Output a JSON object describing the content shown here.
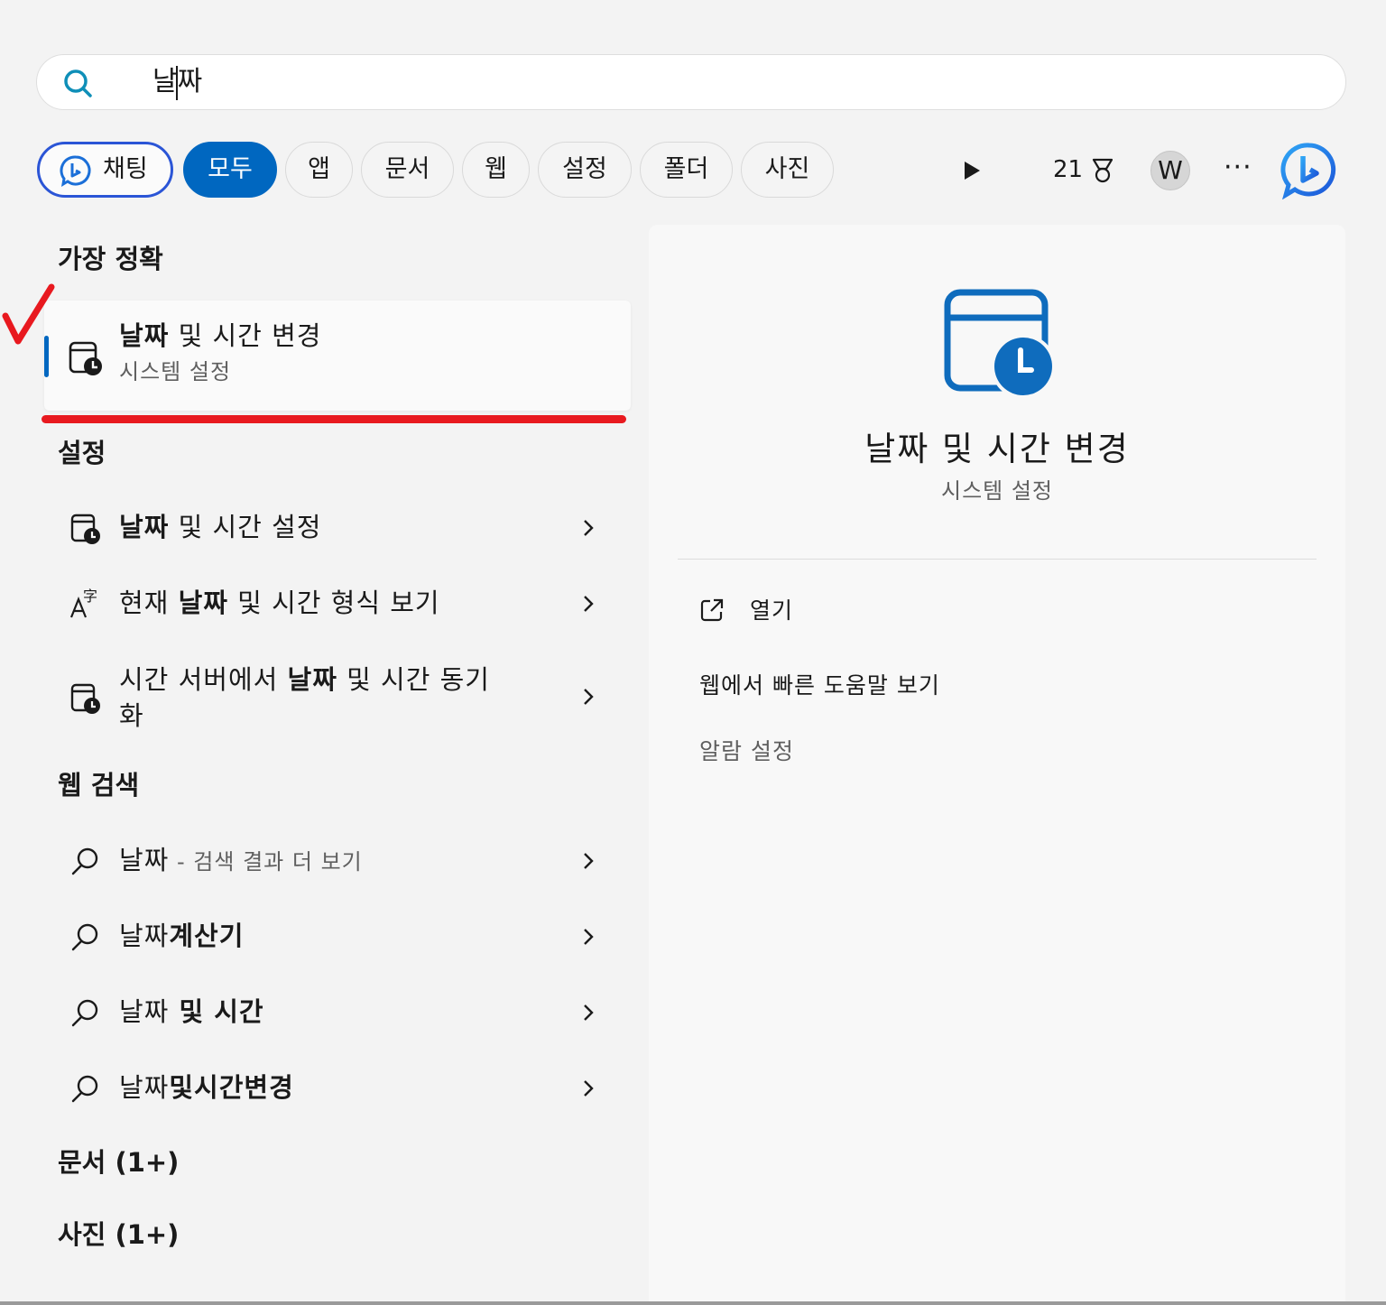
{
  "search": {
    "query": "날짜"
  },
  "filters": {
    "chat": "채팅",
    "tabs": [
      "모두",
      "앱",
      "문서",
      "웹",
      "설정",
      "폴더",
      "사진"
    ]
  },
  "toolbar": {
    "points": "21",
    "avatar_initial": "W",
    "more": "···"
  },
  "best_match": {
    "section": "가장 정확",
    "title_bold": "날짜",
    "title_rest": " 및 시간 변경",
    "subtitle": "시스템 설정"
  },
  "settings": {
    "section": "설정",
    "items": [
      {
        "pre": "",
        "bold": "날짜",
        "post": " 및 시간 설정"
      },
      {
        "pre": "현재 ",
        "bold": "날짜",
        "post": " 및 시간 형식 보기"
      },
      {
        "pre": "시간 서버에서 ",
        "bold": "날짜",
        "post": " 및 시간 동기",
        "line2": "화"
      }
    ]
  },
  "web_search": {
    "section": "웹 검색",
    "items": [
      {
        "plain": "날짜",
        "bold": "",
        "suffix": " - 검색 결과 더 보기"
      },
      {
        "plain": "날짜",
        "bold": "계산기",
        "suffix": ""
      },
      {
        "plain": "날짜",
        "bold": " 및 시간",
        "suffix": ""
      },
      {
        "plain": "날짜",
        "bold": "및시간변경",
        "suffix": ""
      }
    ]
  },
  "documents": {
    "section": "문서 (1+)"
  },
  "photos": {
    "section": "사진 (1+)"
  },
  "detail": {
    "title": "날짜 및 시간 변경",
    "subtitle": "시스템 설정",
    "actions": [
      {
        "label": "열기",
        "icon": "open-external-icon"
      },
      {
        "label": "웹에서 빠른 도움말 보기"
      },
      {
        "label": "알람 설정"
      }
    ]
  },
  "colors": {
    "accent": "#0067c0",
    "annotation_red": "#e8191f",
    "chat_border": "#2b55d6"
  }
}
